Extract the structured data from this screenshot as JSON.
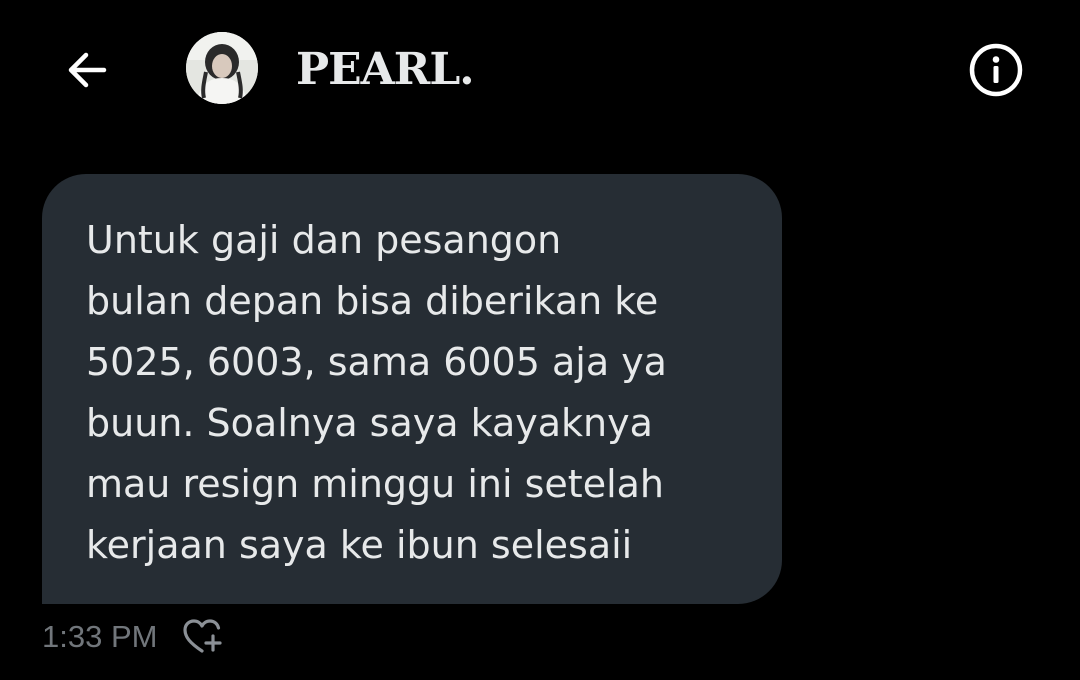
{
  "header": {
    "back_icon": "arrow-left-icon",
    "contact_name": "PEARL.",
    "info_icon": "info-circle-icon"
  },
  "message": {
    "lines": [
      "Untuk gaji dan pesangon",
      "bulan depan bisa diberikan ke",
      "5025, 6003, sama 6005 aja ya",
      "buun. Soalnya saya kayaknya",
      "mau resign minggu ini setelah",
      "kerjaan saya ke ibun selesaii"
    ],
    "timestamp": "1:33 PM",
    "reaction_icon": "heart-add-icon"
  },
  "colors": {
    "background": "#000000",
    "bubble": "#262d34",
    "text": "#e7e9ea",
    "muted": "#71767b"
  }
}
